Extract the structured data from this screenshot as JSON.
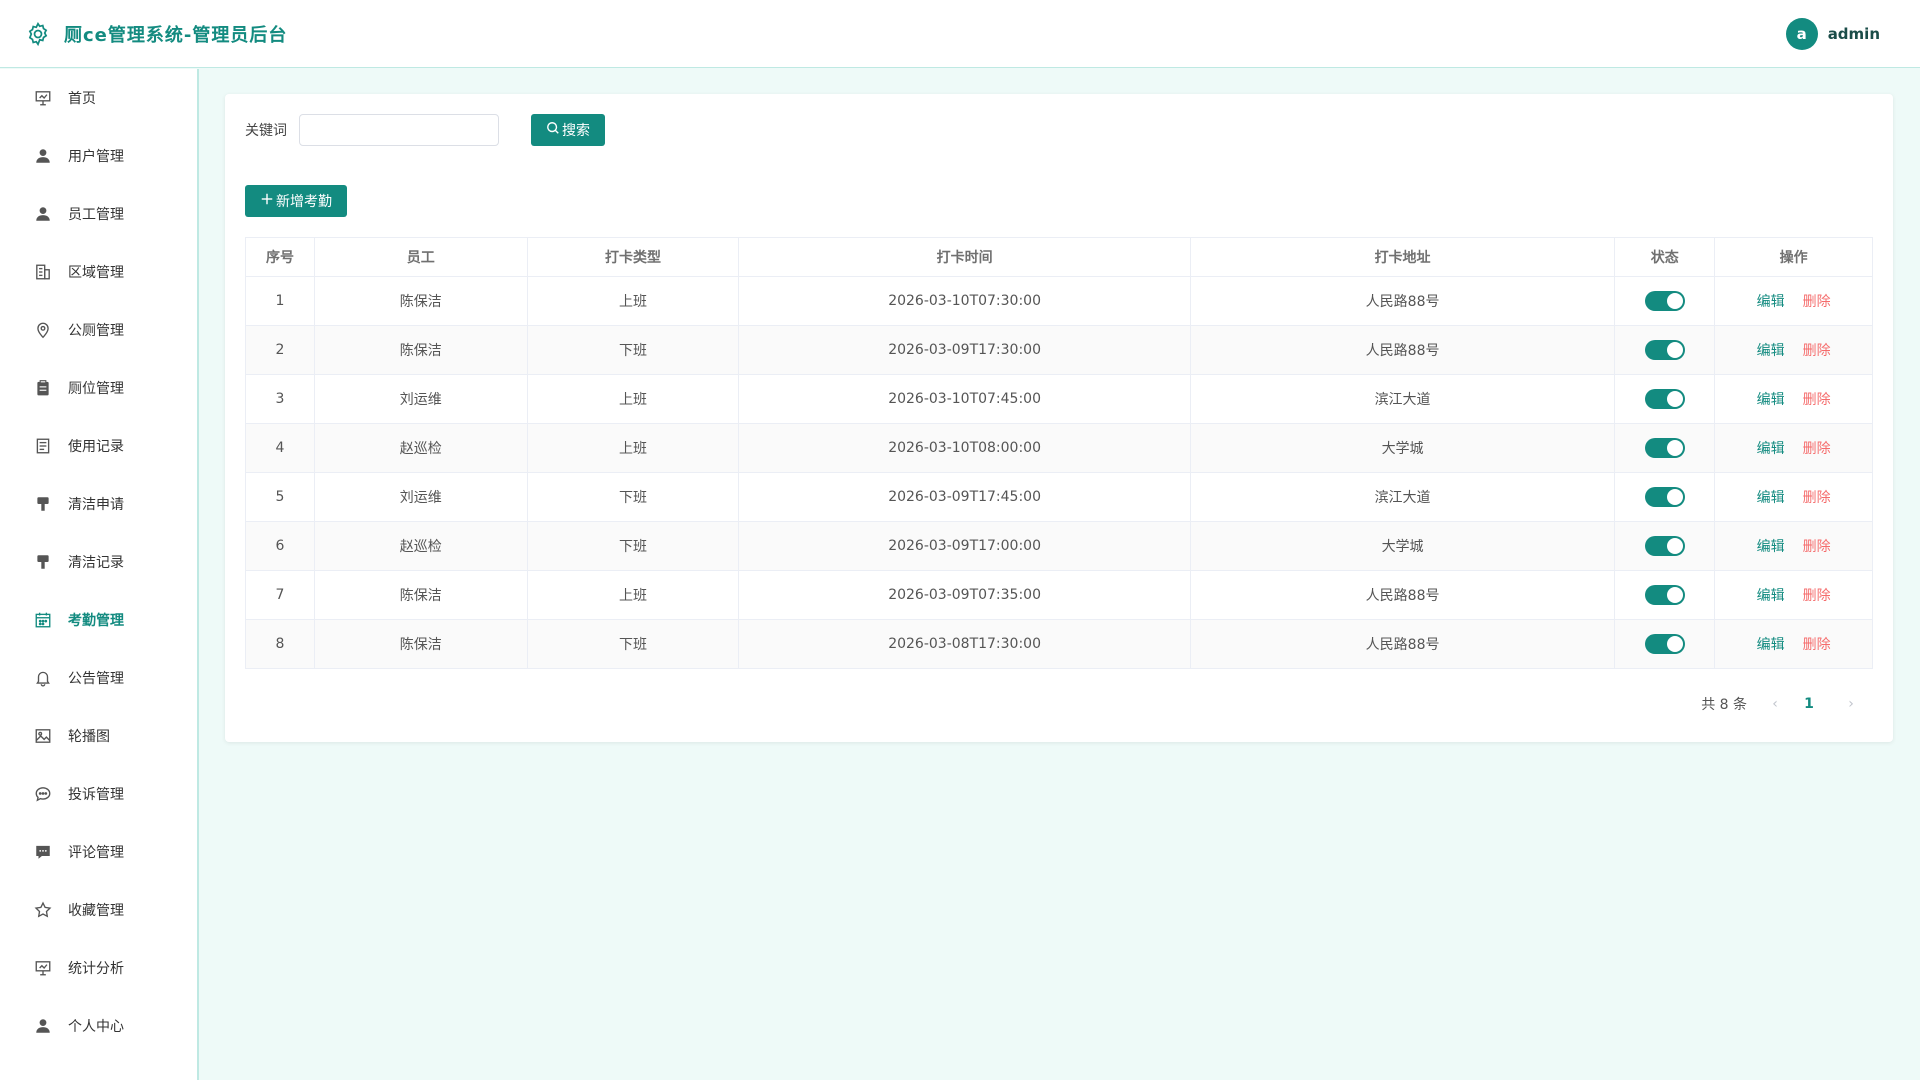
{
  "app": {
    "title": "厕ce管理系统-管理员后台",
    "accent_color": "#138b80"
  },
  "user": {
    "avatar_letter": "a",
    "name": "admin"
  },
  "sidebar": {
    "items": [
      {
        "label": "首页",
        "icon": "presentation-icon"
      },
      {
        "label": "用户管理",
        "icon": "user-icon"
      },
      {
        "label": "员工管理",
        "icon": "user-icon"
      },
      {
        "label": "区域管理",
        "icon": "office-building-icon"
      },
      {
        "label": "公厕管理",
        "icon": "location-pin-icon"
      },
      {
        "label": "厕位管理",
        "icon": "clipboard-icon"
      },
      {
        "label": "使用记录",
        "icon": "document-icon"
      },
      {
        "label": "清洁申请",
        "icon": "brush-icon"
      },
      {
        "label": "清洁记录",
        "icon": "brush-icon"
      },
      {
        "label": "考勤管理",
        "icon": "calendar-icon",
        "active": true
      },
      {
        "label": "公告管理",
        "icon": "bell-icon"
      },
      {
        "label": "轮播图",
        "icon": "picture-icon"
      },
      {
        "label": "投诉管理",
        "icon": "chat-dots-icon"
      },
      {
        "label": "评论管理",
        "icon": "chat-square-icon"
      },
      {
        "label": "收藏管理",
        "icon": "star-icon"
      },
      {
        "label": "统计分析",
        "icon": "presentation-icon"
      },
      {
        "label": "个人中心",
        "icon": "user-icon"
      }
    ]
  },
  "search": {
    "label": "关键词",
    "value": "",
    "placeholder": "",
    "button_label": "搜索"
  },
  "toolbar": {
    "add_label": "新增考勤"
  },
  "table": {
    "columns": [
      "序号",
      "员工",
      "打卡类型",
      "打卡时间",
      "打卡地址",
      "状态",
      "操作"
    ],
    "edit_label": "编辑",
    "delete_label": "删除",
    "rows": [
      {
        "index": "1",
        "employee": "陈保洁",
        "type": "上班",
        "time": "2026-03-10T07:30:00",
        "address": "人民路88号",
        "status": true
      },
      {
        "index": "2",
        "employee": "陈保洁",
        "type": "下班",
        "time": "2026-03-09T17:30:00",
        "address": "人民路88号",
        "status": true
      },
      {
        "index": "3",
        "employee": "刘运维",
        "type": "上班",
        "time": "2026-03-10T07:45:00",
        "address": "滨江大道",
        "status": true
      },
      {
        "index": "4",
        "employee": "赵巡检",
        "type": "上班",
        "time": "2026-03-10T08:00:00",
        "address": "大学城",
        "status": true
      },
      {
        "index": "5",
        "employee": "刘运维",
        "type": "下班",
        "time": "2026-03-09T17:45:00",
        "address": "滨江大道",
        "status": true
      },
      {
        "index": "6",
        "employee": "赵巡检",
        "type": "下班",
        "time": "2026-03-09T17:00:00",
        "address": "大学城",
        "status": true
      },
      {
        "index": "7",
        "employee": "陈保洁",
        "type": "上班",
        "time": "2026-03-09T07:35:00",
        "address": "人民路88号",
        "status": true
      },
      {
        "index": "8",
        "employee": "陈保洁",
        "type": "下班",
        "time": "2026-03-08T17:30:00",
        "address": "人民路88号",
        "status": true
      }
    ]
  },
  "pagination": {
    "total_text": "共 8 条",
    "current_page": "1",
    "prev_symbol": "‹",
    "next_symbol": "›"
  }
}
